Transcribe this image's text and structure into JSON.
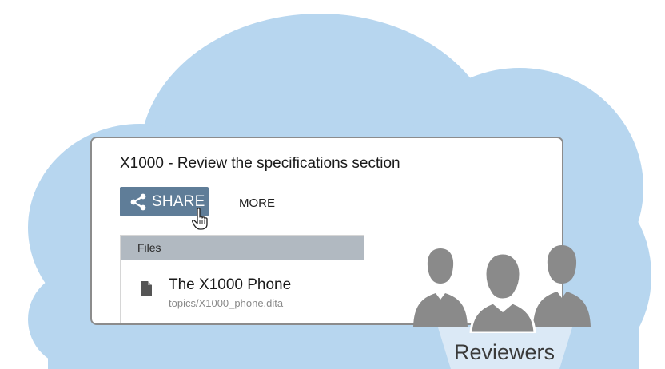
{
  "card": {
    "title": "X1000 - Review the specifications section",
    "share_label": "SHARE",
    "more_label": "MORE"
  },
  "files": {
    "header": "Files",
    "items": [
      {
        "name": "The X1000 Phone",
        "path": "topics/X1000_phone.dita"
      }
    ]
  },
  "reviewers": {
    "label": "Reviewers"
  },
  "icons": {
    "share": "share-icon",
    "cursor": "hand-pointer-icon",
    "file": "document-icon",
    "people": "reviewers-group-icon"
  },
  "colors": {
    "cloud": "#b7d6ef",
    "share_button": "#5f7d98",
    "files_header": "#b1b9c1",
    "people": "#8a8a8a",
    "label_backdrop": "#dbe9f6"
  }
}
